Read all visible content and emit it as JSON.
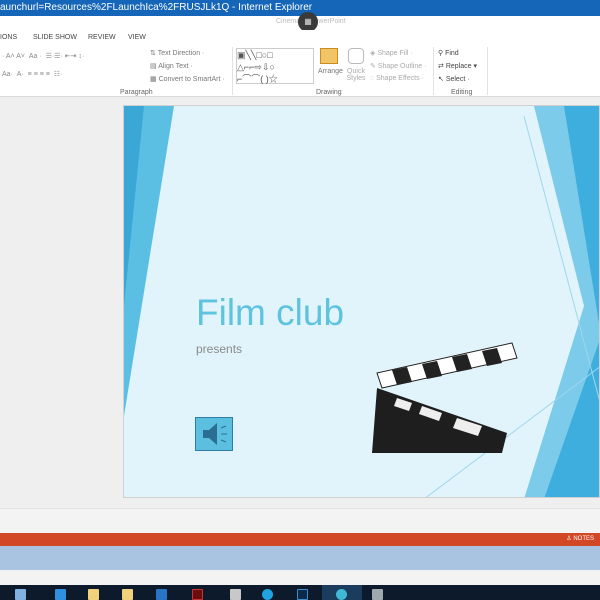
{
  "window": {
    "title": "aunchurl=Resources%2FLaunchIca%2FRUSJLk1Q - Internet Explorer",
    "doc_title": "Cinema ... PowerPoint"
  },
  "tabs": [
    "IONS",
    "SLIDE SHOW",
    "REVIEW",
    "VIEW"
  ],
  "ribbon": {
    "paragraph": {
      "label": "Paragraph",
      "text_direction": "Text Direction",
      "align_text": "Align Text",
      "convert_smartart": "Convert to SmartArt"
    },
    "drawing": {
      "label": "Drawing",
      "arrange": "Arrange",
      "quick_styles": "Quick Styles",
      "shape_fill": "Shape Fill",
      "shape_outline": "Shape Outline",
      "shape_effects": "Shape Effects"
    },
    "editing": {
      "label": "Editing",
      "find": "Find",
      "replace": "Replace",
      "select": "Select"
    }
  },
  "slide": {
    "title": "Film club",
    "subtitle": "presents",
    "accent": "#5ec3df"
  },
  "status": {
    "notes": "NOTES",
    "accent": "#d24726"
  },
  "taskbar": {
    "icons": [
      "explorer-icon",
      "media-icon",
      "folder-icon",
      "folder-icon",
      "outlook-icon",
      "acrobat-icon",
      "app-icon",
      "skype-icon",
      "photoshop-icon",
      "ie-icon",
      "printer-icon"
    ]
  }
}
